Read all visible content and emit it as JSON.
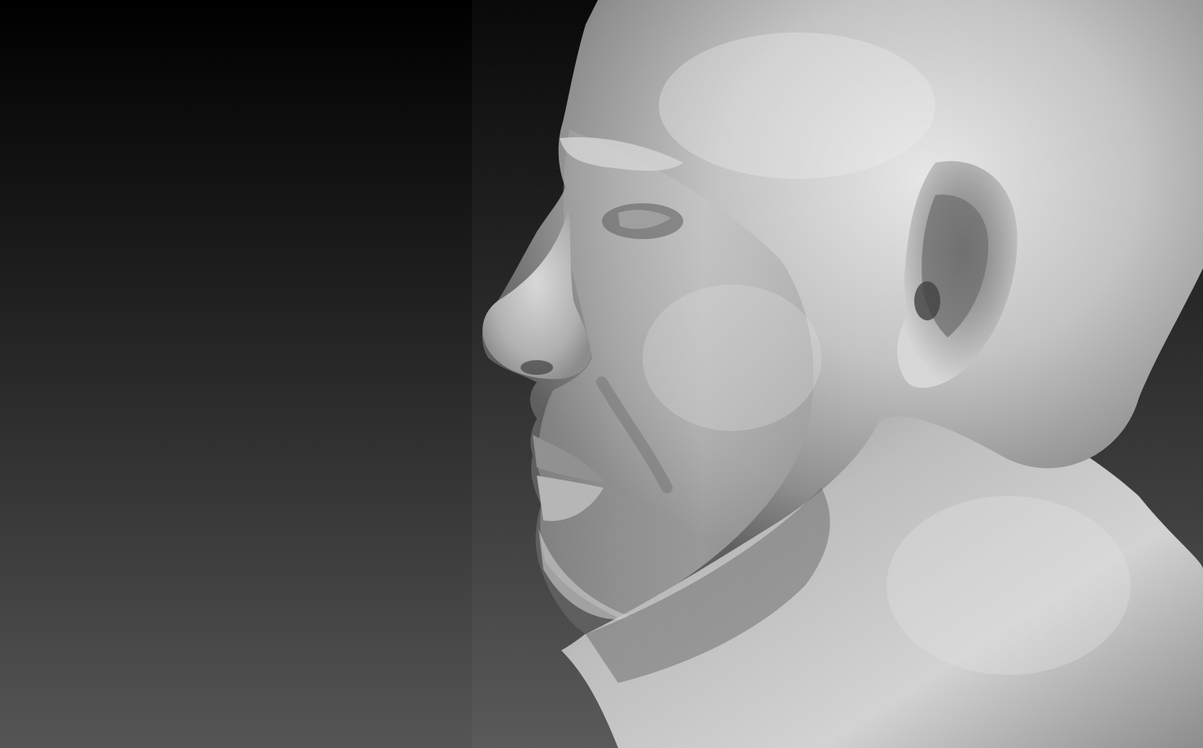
{
  "scene": {
    "subject": "sculpted-male-head-profile",
    "view": "left-side-profile",
    "material": "matte-grey-clay",
    "background_gradient": {
      "top": "#000000",
      "bottom": "#555555"
    },
    "surface_colors": {
      "highlight": "#e6e6e6",
      "midtone": "#a8a8a8",
      "shadow": "#4a4a4a",
      "deep_shadow": "#262626"
    }
  }
}
